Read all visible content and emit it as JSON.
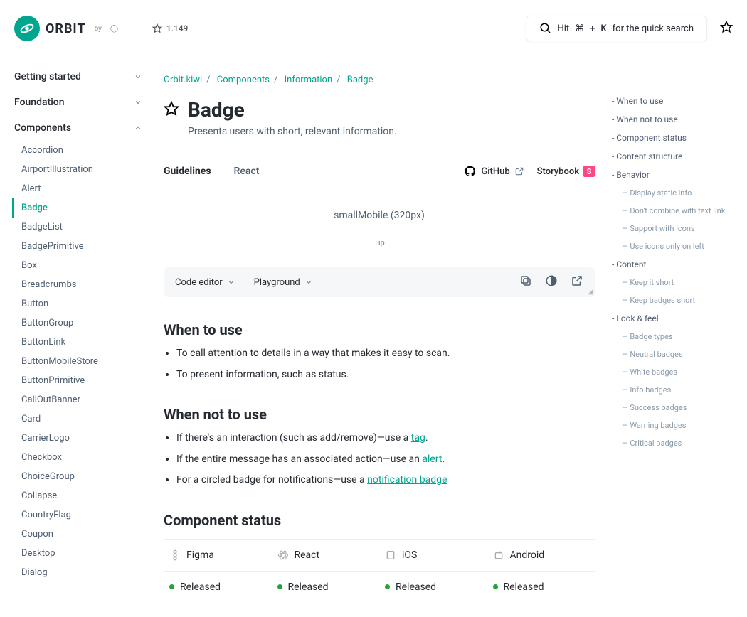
{
  "header": {
    "brand": "ORBIT",
    "byline": "by",
    "star_count": "1.149",
    "search": {
      "hit": "Hit",
      "cmd": "⌘",
      "plus": "+",
      "k": "K",
      "for": "for the quick search"
    }
  },
  "nav": {
    "top": [
      {
        "label": "Getting started",
        "state": "collapsed"
      },
      {
        "label": "Foundation",
        "state": "collapsed"
      },
      {
        "label": "Components",
        "state": "expanded"
      }
    ],
    "components": [
      "Accordion",
      "AirportIllustration",
      "Alert",
      "Badge",
      "BadgeList",
      "BadgePrimitive",
      "Box",
      "Breadcrumbs",
      "Button",
      "ButtonGroup",
      "ButtonLink",
      "ButtonMobileStore",
      "ButtonPrimitive",
      "CallOutBanner",
      "Card",
      "CarrierLogo",
      "Checkbox",
      "ChoiceGroup",
      "Collapse",
      "CountryFlag",
      "Coupon",
      "Desktop",
      "Dialog"
    ],
    "active": "Badge"
  },
  "breadcrumb": [
    "Orbit.kiwi",
    "Components",
    "Information",
    "Badge"
  ],
  "page": {
    "title": "Badge",
    "subtitle": "Presents users with short, relevant information."
  },
  "tabs": {
    "items": [
      "Guidelines",
      "React"
    ],
    "active": "Guidelines",
    "external": [
      {
        "label": "GitHub"
      },
      {
        "label": "Storybook"
      }
    ]
  },
  "preview": {
    "label": "smallMobile (320px)",
    "tip": "Tip"
  },
  "code_bar": {
    "drop1": "Code editor",
    "drop2": "Playground"
  },
  "sections": {
    "when_to_use": {
      "heading": "When to use",
      "items": [
        "To call attention to details in a way that makes it easy to scan.",
        "To present information, such as status."
      ]
    },
    "when_not_to_use": {
      "heading": "When not to use",
      "prefix1": "If there's an interaction (such as add/remove)—use a ",
      "link1": "tag",
      "suffix1": ".",
      "prefix2": "If the entire message has an associated action—use an ",
      "link2": "alert",
      "suffix2": ".",
      "prefix3": "For a circled badge for notifications—use a ",
      "link3": "notification badge",
      "suffix3": ""
    },
    "component_status": {
      "heading": "Component status",
      "platforms": [
        "Figma",
        "React",
        "iOS",
        "Android"
      ],
      "states": [
        "Released",
        "Released",
        "Released",
        "Released"
      ]
    }
  },
  "toc": {
    "items": [
      {
        "l": 1,
        "label": "When to use"
      },
      {
        "l": 1,
        "label": "When not to use"
      },
      {
        "l": 1,
        "label": "Component status"
      },
      {
        "l": 1,
        "label": "Content structure"
      },
      {
        "l": 1,
        "label": "Behavior"
      },
      {
        "l": 2,
        "label": "Display static info"
      },
      {
        "l": 2,
        "label": "Don't combine with text link"
      },
      {
        "l": 2,
        "label": "Support with icons"
      },
      {
        "l": 2,
        "label": "Use icons only on left"
      },
      {
        "l": 1,
        "label": "Content"
      },
      {
        "l": 2,
        "label": "Keep it short"
      },
      {
        "l": 2,
        "label": "Keep badges short"
      },
      {
        "l": 1,
        "label": "Look & feel"
      },
      {
        "l": 2,
        "label": "Badge types"
      },
      {
        "l": 2,
        "label": "Neutral badges"
      },
      {
        "l": 2,
        "label": "White badges"
      },
      {
        "l": 2,
        "label": "Info badges"
      },
      {
        "l": 2,
        "label": "Success badges"
      },
      {
        "l": 2,
        "label": "Warning badges"
      },
      {
        "l": 2,
        "label": "Critical badges"
      }
    ]
  }
}
